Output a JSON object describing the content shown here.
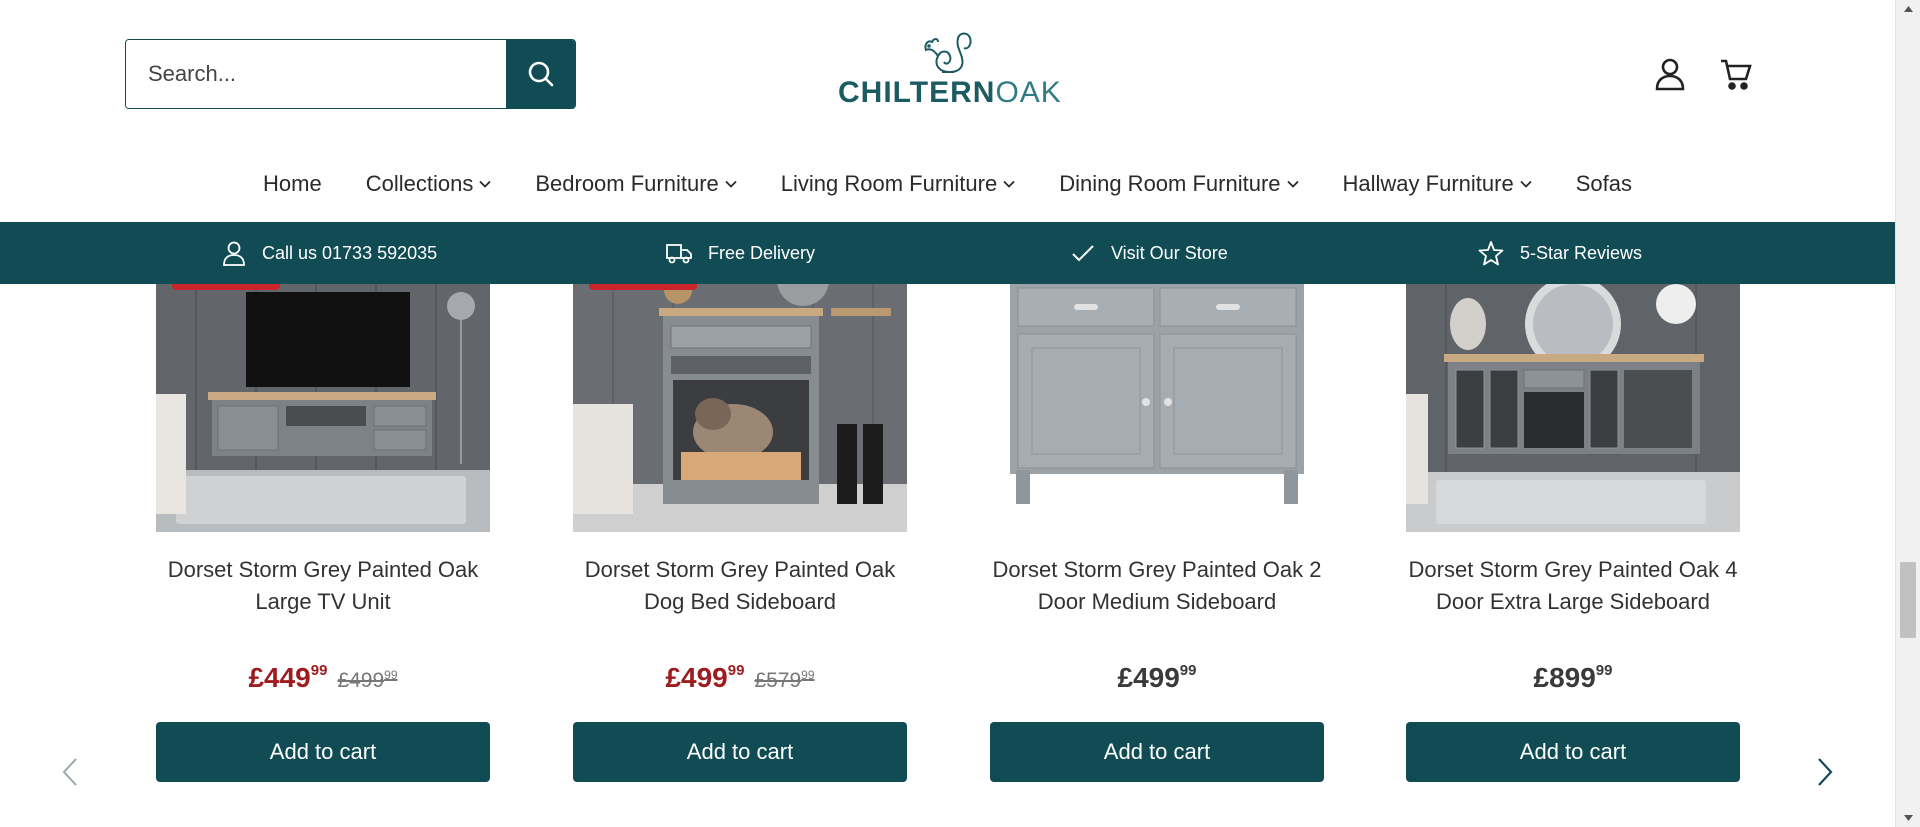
{
  "header": {
    "search_placeholder": "Search...",
    "logo_part1": "CHILTERN",
    "logo_part2": "OAK"
  },
  "nav": {
    "items": [
      {
        "label": "Home",
        "dropdown": false
      },
      {
        "label": "Collections",
        "dropdown": true
      },
      {
        "label": "Bedroom Furniture",
        "dropdown": true
      },
      {
        "label": "Living Room Furniture",
        "dropdown": true
      },
      {
        "label": "Dining Room Furniture",
        "dropdown": true
      },
      {
        "label": "Hallway Furniture",
        "dropdown": true
      },
      {
        "label": "Sofas",
        "dropdown": false
      }
    ]
  },
  "infobar": {
    "items": [
      {
        "icon": "person-icon",
        "label": "Call us 01733 592035"
      },
      {
        "icon": "truck-icon",
        "label": "Free Delivery"
      },
      {
        "icon": "checkmark-icon",
        "label": "Visit Our Store"
      },
      {
        "icon": "star-icon",
        "label": "5-Star Reviews"
      }
    ]
  },
  "products": [
    {
      "title": "Dorset Storm Grey Painted Oak Large TV Unit",
      "price_main": "£449",
      "price_pence": "99",
      "was_main": "£499",
      "was_pence": "99",
      "on_sale": true,
      "button": "Add to cart"
    },
    {
      "title": "Dorset Storm Grey Painted Oak Dog Bed Sideboard",
      "price_main": "£499",
      "price_pence": "99",
      "was_main": "£579",
      "was_pence": "99",
      "on_sale": true,
      "button": "Add to cart"
    },
    {
      "title": "Dorset Storm Grey Painted Oak 2 Door Medium Sideboard",
      "price_main": "£499",
      "price_pence": "99",
      "was_main": "",
      "was_pence": "",
      "on_sale": false,
      "button": "Add to cart"
    },
    {
      "title": "Dorset Storm Grey Painted Oak 4 Door Extra Large Sideboard",
      "price_main": "£899",
      "price_pence": "99",
      "was_main": "",
      "was_pence": "",
      "on_sale": false,
      "button": "Add to cart"
    }
  ],
  "colors": {
    "brand_teal": "#114c55",
    "sale_red": "#9d1c1f",
    "badge_red": "#c8252c"
  }
}
